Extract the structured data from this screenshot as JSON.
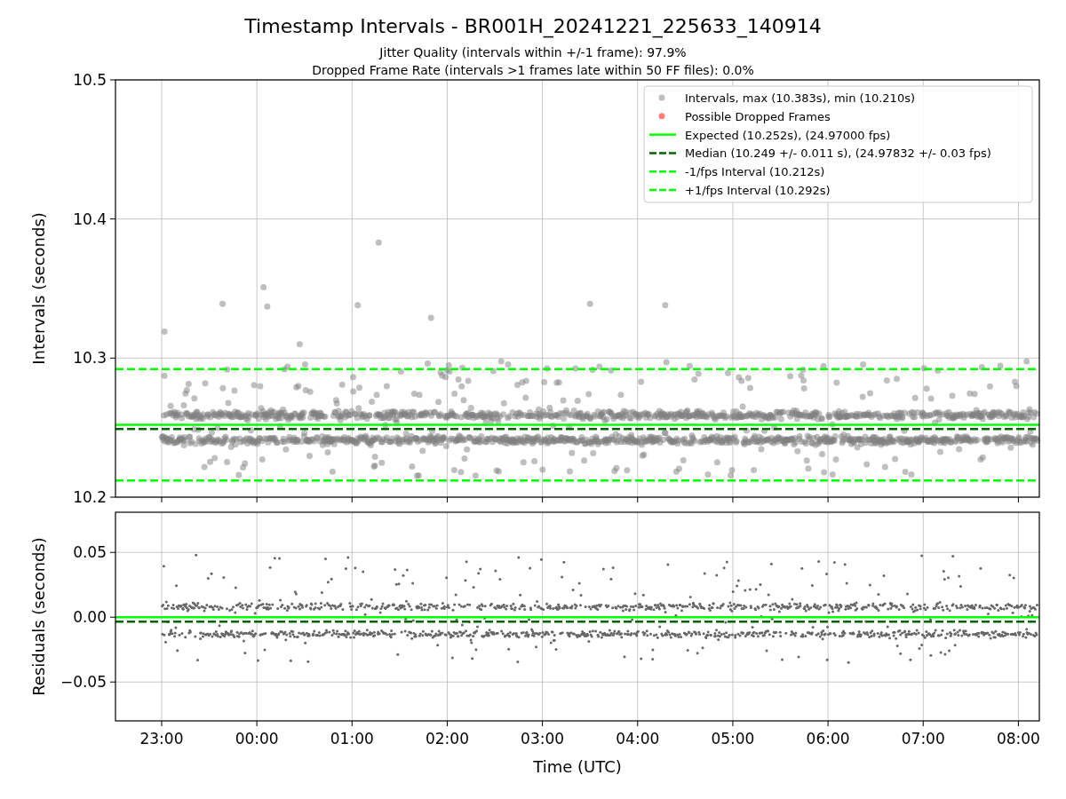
{
  "title": "Timestamp Intervals - BR001H_20241221_225633_140914",
  "subtitles": [
    "Jitter Quality (intervals within +/-1 frame): 97.9%",
    "Dropped Frame Rate (intervals >1 frames late within 50 FF files): 0.0%"
  ],
  "intervals_plot": {
    "chart_data": {
      "type": "scatter",
      "ylabel": "Intervals (seconds)",
      "legend": "upper right",
      "grid": true,
      "ylim": [
        10.2,
        10.5
      ],
      "yticks": [
        10.2,
        10.3,
        10.4,
        10.5
      ],
      "series": [
        {
          "name": "Intervals, max (10.383s), min (10.210s)",
          "color": "#808080"
        },
        {
          "name": "Possible Dropped Frames",
          "color": "#ff0000"
        }
      ],
      "ref_lines": [
        {
          "axis": "y",
          "value": 10.252,
          "label": "Expected (10.252s), (24.97000 fps)",
          "color": "#00ff00"
        },
        {
          "axis": "y",
          "value": 10.249,
          "label": "Median (10.249 +/- 0.011 s), (24.97832 +/- 0.03 fps)",
          "color": "#006400"
        },
        {
          "axis": "y",
          "value": 10.212,
          "label": "-1/fps Interval (10.212s)",
          "color": "#00ff00"
        },
        {
          "axis": "y",
          "value": 10.292,
          "label": "+1/fps Interval (10.292s)",
          "color": "#00ff00"
        }
      ]
    }
  },
  "residuals_plot": {
    "chart_data": {
      "type": "scatter",
      "xlabel": "Time (UTC)",
      "ylabel": "Residuals (seconds)",
      "grid": true,
      "ylim": [
        -0.08,
        0.081
      ],
      "yticks": [
        {
          "value": -0.05,
          "label": "−0.05"
        },
        {
          "value": 0,
          "label": "0.00"
        },
        {
          "value": 0.05,
          "label": "0.05"
        }
      ],
      "categories": [
        "23:00",
        "00:00",
        "01:00",
        "02:00",
        "03:00",
        "04:00",
        "05:00",
        "06:00",
        "07:00",
        "08:00"
      ],
      "ref_lines": [
        {
          "axis": "y",
          "value": 0,
          "color": "#00ff00"
        },
        {
          "axis": "y",
          "value": -0.0034,
          "color": "#006400"
        }
      ]
    }
  }
}
